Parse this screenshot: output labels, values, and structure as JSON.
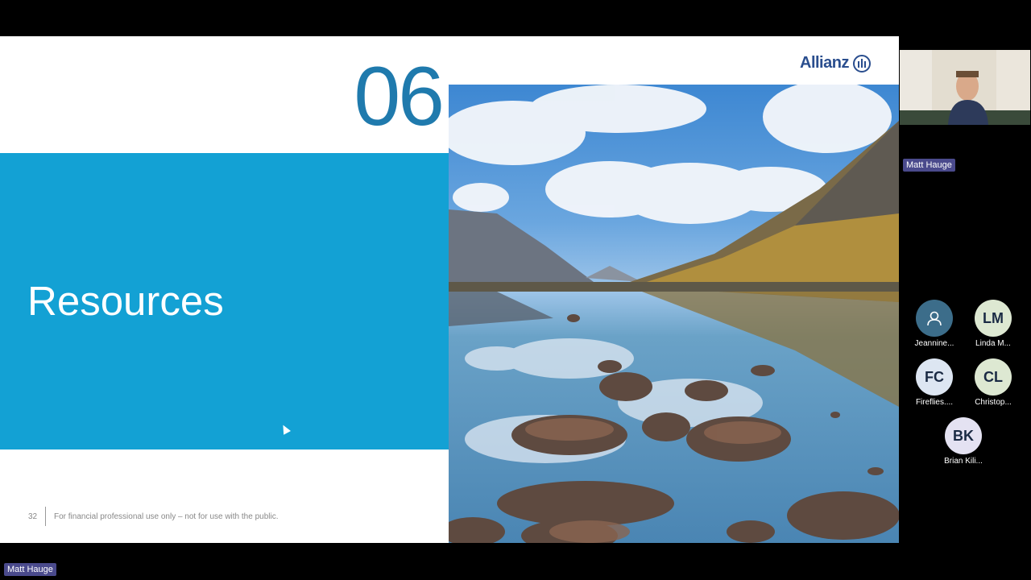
{
  "slide": {
    "section_number": "06",
    "title": "Resources",
    "brand": "Allianz",
    "page_number": "32",
    "disclaimer": "For financial professional use only – not for use with the public."
  },
  "meeting": {
    "speaker_name": "Matt Hauge",
    "bottom_label": "Matt Hauge",
    "participants": [
      {
        "initials": "",
        "name": "Jeannine...",
        "icon": "person-icon",
        "color": "#3c6d8a"
      },
      {
        "initials": "LM",
        "name": "Linda M...",
        "color": "#dde8d2"
      },
      {
        "initials": "FC",
        "name": "Fireflies....",
        "color": "#dde6f2"
      },
      {
        "initials": "CL",
        "name": "Christop...",
        "color": "#dde8d2"
      },
      {
        "initials": "BK",
        "name": "Brian Kili...",
        "color": "#e4e2f2"
      }
    ]
  }
}
